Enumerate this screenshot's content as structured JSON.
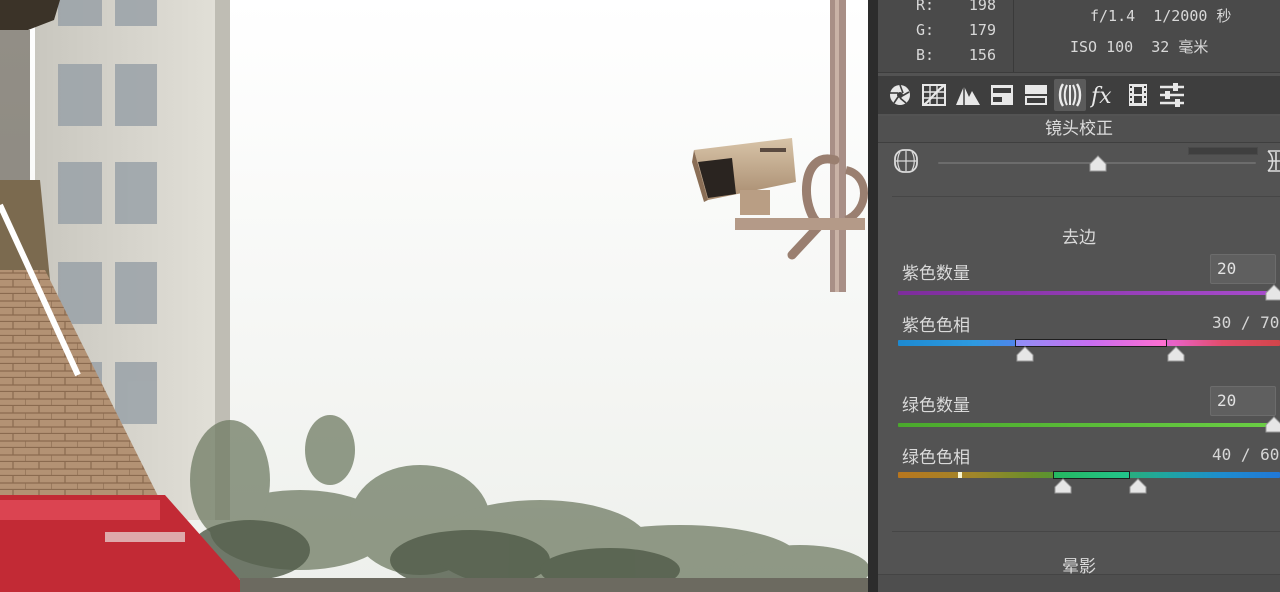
{
  "info": {
    "rgb": [
      {
        "key": "R:",
        "value": "198"
      },
      {
        "key": "G:",
        "value": "179"
      },
      {
        "key": "B:",
        "value": "156"
      }
    ],
    "exif_line1": "f/1.4  1/2000 秒",
    "exif_line2": "ISO 100  32 毫米"
  },
  "tabs": [
    {
      "name": "basic-tab",
      "icon": "aperture-icon"
    },
    {
      "name": "tone-curve-tab",
      "icon": "curve-grid-icon"
    },
    {
      "name": "detail-tab",
      "icon": "mountains-icon"
    },
    {
      "name": "hsl-tab",
      "icon": "hsl-bars-icon"
    },
    {
      "name": "split-toning-tab",
      "icon": "split-toning-icon"
    },
    {
      "name": "lens-corrections-tab",
      "icon": "lens-icon",
      "active": true
    },
    {
      "name": "effects-tab",
      "icon": "fx-icon"
    },
    {
      "name": "camera-calibration-tab",
      "icon": "film-strip-icon"
    },
    {
      "name": "presets-tab",
      "icon": "sliders-icon"
    }
  ],
  "section_title": "镜头校正",
  "defringe": {
    "title": "去边",
    "purple_amount": {
      "label": "紫色数量",
      "value": "20",
      "fraction": 1.0
    },
    "purple_hue": {
      "label": "紫色色相",
      "value": "30 / 70",
      "low": 30,
      "high": 70
    },
    "green_amount": {
      "label": "绿色数量",
      "value": "20",
      "fraction": 1.0
    },
    "green_hue": {
      "label": "绿色色相",
      "value": "40 / 60",
      "low": 40,
      "high": 60
    }
  },
  "vignette_title": "晕影",
  "colors": {
    "panel_bg": "#535353",
    "accent_purple": "#9a3fc6",
    "accent_green": "#5ec23a"
  }
}
